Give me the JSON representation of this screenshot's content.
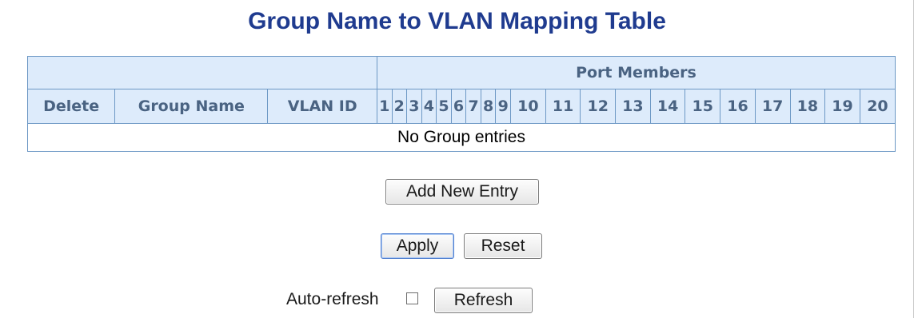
{
  "title": "Group Name to VLAN Mapping Table",
  "table": {
    "group_header": "Port Members",
    "columns": [
      "Delete",
      "Group Name",
      "VLAN ID"
    ],
    "ports": [
      "1",
      "2",
      "3",
      "4",
      "5",
      "6",
      "7",
      "8",
      "9",
      "10",
      "11",
      "12",
      "13",
      "14",
      "15",
      "16",
      "17",
      "18",
      "19",
      "20"
    ],
    "empty_message": "No Group entries"
  },
  "buttons": {
    "add_new_entry": "Add New Entry",
    "apply": "Apply",
    "reset": "Reset",
    "refresh": "Refresh"
  },
  "auto_refresh": {
    "label": "Auto-refresh",
    "checked": false
  },
  "colors": {
    "title": "#1f3b8f",
    "header_bg": "#ddebfb",
    "header_text": "#4a6382",
    "border": "#6d98c5"
  }
}
